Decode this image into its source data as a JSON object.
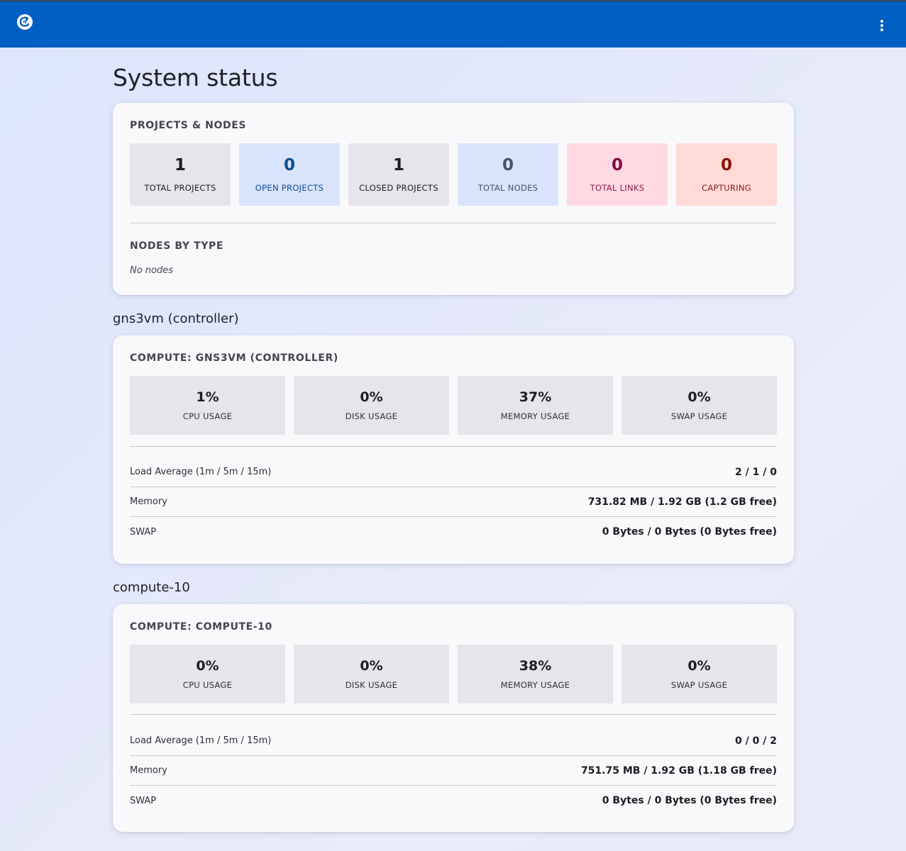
{
  "header": {
    "logo_icon": "gns3-chameleon-logo",
    "menu_icon": "more-vert-icon",
    "bg_color": "#005fc2"
  },
  "page": {
    "title": "System status"
  },
  "projects_nodes": {
    "label": "PROJECTS & NODES",
    "stats": [
      {
        "value": "1",
        "label": "TOTAL PROJECTS"
      },
      {
        "value": "0",
        "label": "OPEN PROJECTS"
      },
      {
        "value": "1",
        "label": "CLOSED PROJECTS"
      },
      {
        "value": "0",
        "label": "TOTAL NODES"
      },
      {
        "value": "0",
        "label": "TOTAL LINKS"
      },
      {
        "value": "0",
        "label": "CAPTURING"
      }
    ],
    "nodes_by_type_label": "NODES BY TYPE",
    "nodes_empty": "No nodes"
  },
  "computes": [
    {
      "title": "gns3vm (controller)",
      "label": "COMPUTE: GNS3VM (CONTROLLER)",
      "usage": [
        {
          "value": "1%",
          "label": "CPU USAGE"
        },
        {
          "value": "0%",
          "label": "DISK USAGE"
        },
        {
          "value": "37%",
          "label": "MEMORY USAGE"
        },
        {
          "value": "0%",
          "label": "SWAP USAGE"
        }
      ],
      "rows": [
        {
          "key": "Load Average (1m / 5m / 15m)",
          "value": "2 / 1 / 0"
        },
        {
          "key": "Memory",
          "value": "731.82 MB / 1.92 GB (1.2 GB free)"
        },
        {
          "key": "SWAP",
          "value": "0 Bytes / 0 Bytes (0 Bytes free)"
        }
      ]
    },
    {
      "title": "compute-10",
      "label": "COMPUTE: COMPUTE-10",
      "usage": [
        {
          "value": "0%",
          "label": "CPU USAGE"
        },
        {
          "value": "0%",
          "label": "DISK USAGE"
        },
        {
          "value": "38%",
          "label": "MEMORY USAGE"
        },
        {
          "value": "0%",
          "label": "SWAP USAGE"
        }
      ],
      "rows": [
        {
          "key": "Load Average (1m / 5m / 15m)",
          "value": "0 / 0 / 2"
        },
        {
          "key": "Memory",
          "value": "751.75 MB / 1.92 GB (1.18 GB free)"
        },
        {
          "key": "SWAP",
          "value": "0 Bytes / 0 Bytes (0 Bytes free)"
        }
      ]
    }
  ]
}
